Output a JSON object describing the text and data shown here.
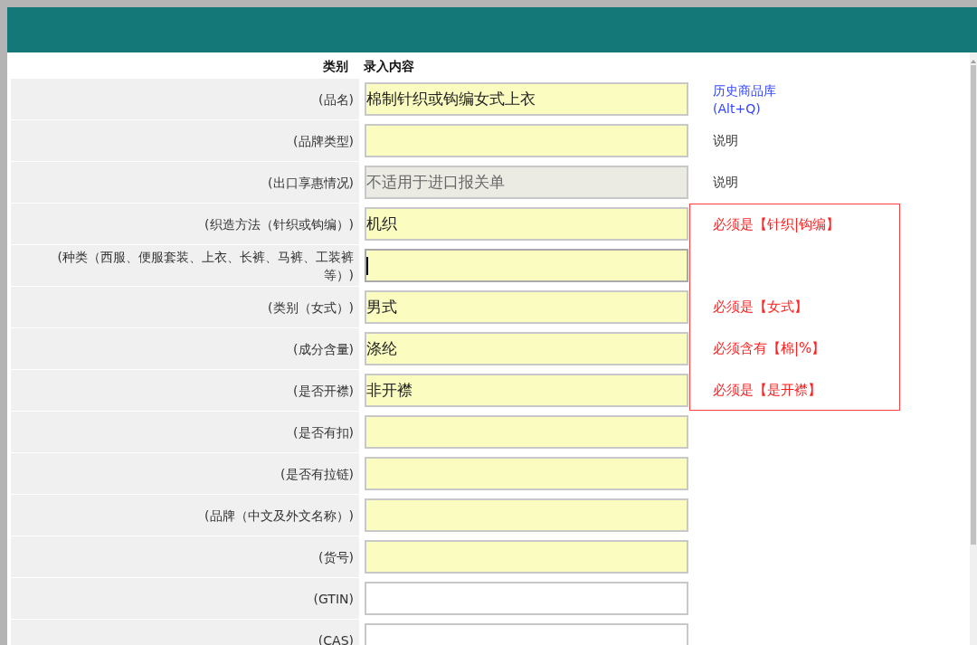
{
  "table": {
    "columns": [
      "类别",
      "录入内容"
    ],
    "rows": [
      {
        "label": "(品名)",
        "kind": "required",
        "value": "棉制针织或钩编女式上衣",
        "focused": false,
        "note": {
          "kind": "link",
          "lines": [
            "历史商品库",
            "(Alt+Q)"
          ]
        }
      },
      {
        "label": "(品牌类型)",
        "kind": "required",
        "value": "",
        "focused": false,
        "note": {
          "kind": "text",
          "lines": [
            "说明"
          ]
        }
      },
      {
        "label": "(出口享惠情况)",
        "kind": "disabled",
        "value": "不适用于进口报关单",
        "focused": false,
        "note": {
          "kind": "text",
          "lines": [
            "说明"
          ]
        }
      },
      {
        "label": "(织造方法（针织或钩编）)",
        "kind": "required",
        "value": "机织",
        "focused": false,
        "error": "必须是【针织|钩编】"
      },
      {
        "label": "(种类（西服、便服套装、上衣、长裤、马裤、工装裤等）)",
        "kind": "required",
        "value": "",
        "focused": true
      },
      {
        "label": "(类别（女式）)",
        "kind": "required",
        "value": "男式",
        "focused": false,
        "error": "必须是【女式】"
      },
      {
        "label": "(成分含量)",
        "kind": "required",
        "value": "涤纶",
        "focused": false,
        "error": "必须含有【棉|%】"
      },
      {
        "label": "(是否开襟)",
        "kind": "required",
        "value": "非开襟",
        "focused": false,
        "error": "必须是【是开襟】"
      },
      {
        "label": "(是否有扣)",
        "kind": "required",
        "value": "",
        "focused": false
      },
      {
        "label": "(是否有拉链)",
        "kind": "required",
        "value": "",
        "focused": false
      },
      {
        "label": "(品牌（中文及外文名称）)",
        "kind": "required",
        "value": "",
        "focused": false
      },
      {
        "label": "(货号)",
        "kind": "required",
        "value": "",
        "focused": false
      },
      {
        "label": "(GTIN)",
        "kind": "optional",
        "value": "",
        "focused": false
      },
      {
        "label": "(CAS)",
        "kind": "optional",
        "value": "",
        "focused": false
      }
    ]
  }
}
